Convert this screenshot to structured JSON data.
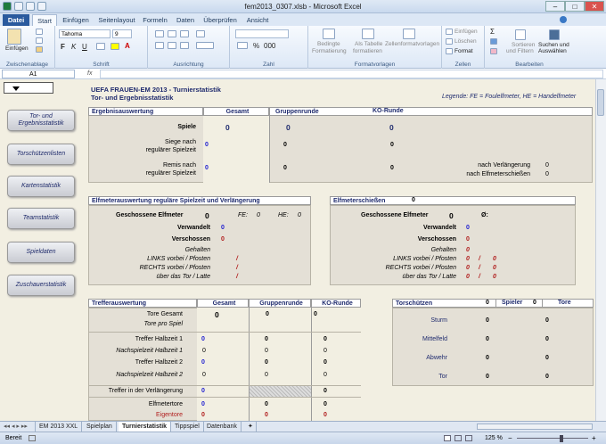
{
  "window": {
    "title": "fem2013_0307.xlsb  -  Microsoft Excel"
  },
  "tabs": [
    "Datei",
    "Start",
    "Einfügen",
    "Seitenlayout",
    "Formeln",
    "Daten",
    "Überprüfen",
    "Ansicht"
  ],
  "ribbon": {
    "paste": "Einfügen",
    "clipboard": "Zwischenablage",
    "font_name": "Tahoma",
    "font_size": "9",
    "font": "Schrift",
    "alignment": "Ausrichtung",
    "number": "Zahl",
    "cond_format_1": "Bedingte",
    "cond_format_2": "Formatierung ",
    "as_table_1": "Als Tabelle",
    "as_table_2": "formatieren ",
    "cell_styles": "Zellenformatvorlagen ",
    "styles": "Formatvorlagen",
    "insert": "Einfügen ",
    "delete": "Löschen ",
    "format": "Format ",
    "cells": "Zellen",
    "sort_1": "Sortieren",
    "sort_2": "und Filtern ",
    "find_1": "Suchen und",
    "find_2": "Auswählen ",
    "editing": "Bearbeiten"
  },
  "formula_bar": {
    "name_box": "A1",
    "fx": "fx",
    "value": ""
  },
  "sheet": {
    "main_title": "UEFA FRAUEN-EM 2013 - Turnierstatistik",
    "sub_title": "Tor- und Ergebnisstatistik",
    "legend": "Legende:  FE = Foulelfmeter, HE = Handelfmeter",
    "nav_buttons": [
      "Tor- und\nErgebnisstatistik",
      "Torschützenlisten",
      "Kartenstatistik",
      "Teamstatistik",
      "Spieldaten",
      "Zuschauerstatistik"
    ],
    "ergebnis": {
      "header": "Ergebnisauswertung",
      "col_total": "Gesamt",
      "col_group": "Gruppenrunde",
      "col_ko": "KO-Runde",
      "rows": [
        {
          "label": "Spiele",
          "total": "0",
          "group": "0",
          "ko": "0"
        },
        {
          "label": "Siege nach\nregulärer Spielzeit",
          "total": "0",
          "group": "0",
          "ko": "0"
        },
        {
          "label": "Remis nach\nregulärer Spielzeit",
          "total": "0",
          "group": "0",
          "ko": "0"
        }
      ],
      "extra": [
        {
          "label": "nach Verlängerung",
          "value": "0"
        },
        {
          "label": "nach Elfmeterschießen",
          "value": "0"
        }
      ]
    },
    "elfmeter": {
      "header": "Elfmeterauswertung reguläre Spielzeit und Verlängerung",
      "shot_label": "Geschossene Elfmeter",
      "shot_value": "0",
      "fe_label": "FE:",
      "fe_value": "0",
      "he_label": "HE:",
      "he_value": "0",
      "converted_label": "Verwandelt",
      "converted_value": "0",
      "missed_label": "Verschossen",
      "missed_value": "0",
      "saved_label": "Gehalten",
      "left_label": "LINKS  vorbei  /  Pfosten",
      "left_value": "/",
      "right_label": "RECHTS  vorbei  /  Pfosten",
      "right_value": "/",
      "over_label": "über das Tor  /  Latte",
      "over_value": "/"
    },
    "shootout": {
      "header": "Elfmeterschießen",
      "header_value": "0",
      "shot_label": "Geschossene Elfmeter",
      "shot_value": "0",
      "avg_label": "Ø:",
      "converted_label": "Verwandelt",
      "converted_value": "0",
      "missed_label": "Verschossen",
      "missed_value": "0",
      "saved_label": "Gehalten",
      "saved_value": "0",
      "left_label": "LINKS  vorbei  /  Pfosten",
      "left_a": "0",
      "left_sep": "/",
      "left_b": "0",
      "right_label": "RECHTS  vorbei  /  Pfosten",
      "right_a": "0",
      "right_sep": "/",
      "right_b": "0",
      "over_label": "über das Tor  /  Latte",
      "over_a": "0",
      "over_sep": "/",
      "over_b": "0"
    },
    "treffer": {
      "header": "Trefferauswertung",
      "col_total": "Gesamt",
      "col_group": "Gruppenrunde",
      "col_ko": "KO-Runde",
      "rows": [
        {
          "label": "Tore  Gesamt",
          "total": "0",
          "group": "0",
          "ko": "0"
        },
        {
          "label": "Tore pro Spiel",
          "total": "",
          "group": "",
          "ko": ""
        },
        {
          "label": "Treffer Halbzeit  1",
          "total": "0",
          "group": "0",
          "ko": "0"
        },
        {
          "label": "Nachspielzeit Halbzeit 1",
          "total": "0",
          "group": "0",
          "ko": "0"
        },
        {
          "label": "Treffer Halbzeit  2",
          "total": "0",
          "group": "0",
          "ko": "0"
        },
        {
          "label": "Nachspielzeit Halbzeit 2",
          "total": "0",
          "group": "0",
          "ko": "0"
        },
        {
          "label": "Treffer in der Verlängerung",
          "total": "0",
          "group": "",
          "ko": "0"
        },
        {
          "label": "Elfmetertore",
          "total": "0",
          "group": "0",
          "ko": "0"
        },
        {
          "label": "Eigentore",
          "total": "0",
          "group": "0",
          "ko": "0"
        }
      ]
    },
    "scorers": {
      "header": "Torschützen",
      "header_value": "0",
      "col_players": "Spieler",
      "col_players_value": "0",
      "col_goals": "Tore",
      "rows": [
        {
          "label": "Sturm",
          "players": "0",
          "goals": "0"
        },
        {
          "label": "Mittelfeld",
          "players": "0",
          "goals": "0"
        },
        {
          "label": "Abwehr",
          "players": "0",
          "goals": "0"
        },
        {
          "label": "Tor",
          "players": "0",
          "goals": "0"
        }
      ]
    }
  },
  "sheet_tabs": [
    "EM 2013 XXL",
    "Spielplan",
    "Turnierstatistik",
    "Tippspiel",
    "Datenbank"
  ],
  "status": {
    "ready": "Bereit",
    "zoom": "125 %"
  }
}
